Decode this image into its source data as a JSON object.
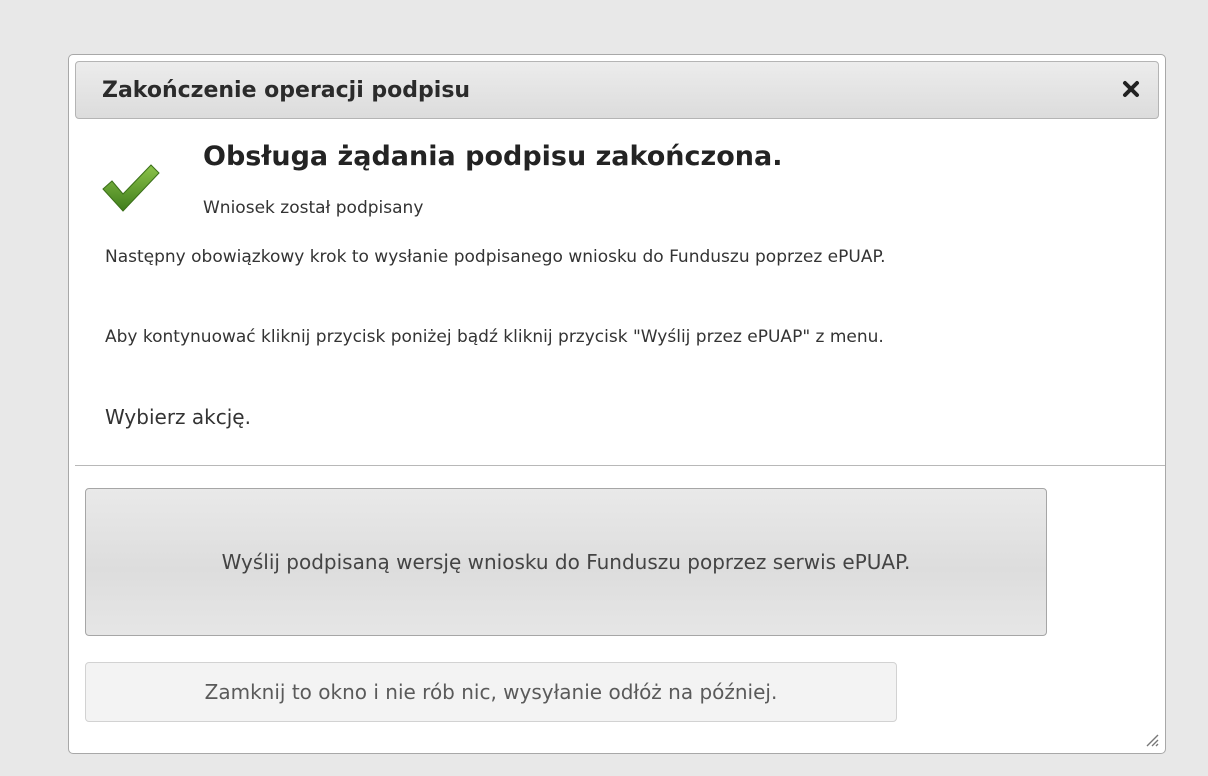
{
  "dialog": {
    "title": "Zakończenie operacji podpisu",
    "close_icon": "close-icon",
    "status_icon": "checkmark-icon",
    "heading": "Obsługa żądania podpisu zakończona.",
    "subheading": "Wniosek został podpisany",
    "paragraph1": "Następny obowiązkowy krok to wysłanie podpisanego wniosku do Funduszu poprzez ePUAP.",
    "paragraph2": "Aby kontynuować kliknij przycisk poniżej bądź kliknij przycisk \"Wyślij przez ePUAP\" z menu.",
    "prompt": "Wybierz akcję.",
    "buttons": {
      "send_label": "Wyślij podpisaną wersję wniosku do Funduszu poprzez serwis ePUAP.",
      "close_label": "Zamknij to okno i nie rób nic, wysyłanie odłóż na później."
    },
    "resize_icon": "resize-handle-icon"
  },
  "colors": {
    "check_green": "#5f9e2c",
    "title_bar": "#e2e2e2",
    "page_bg": "#e8e8e8"
  }
}
